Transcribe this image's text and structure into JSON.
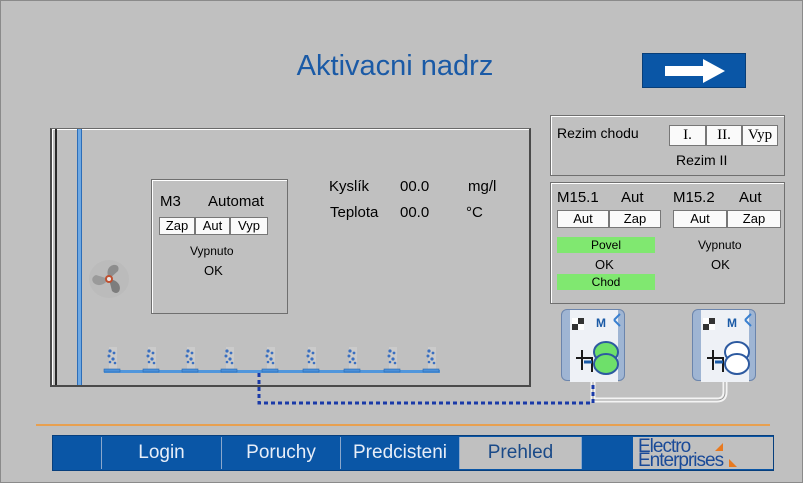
{
  "header": {
    "title": "Aktivacni nadrz",
    "next_icon": "right-arrow-icon"
  },
  "m3": {
    "name": "M3",
    "mode": "Automat",
    "buttons": [
      "Zap",
      "Aut",
      "Vyp"
    ],
    "state": "Vypnuto",
    "status": "OK"
  },
  "readings": {
    "oxygen_label": "Kyslík",
    "oxygen_value": "00.0",
    "oxygen_unit": "mg/l",
    "temp_label": "Teplota",
    "temp_value": "00.0",
    "temp_unit": "°C"
  },
  "rezim": {
    "label": "Rezim chodu",
    "buttons": [
      "I.",
      "II.",
      "Vyp"
    ],
    "current": "Rezim II"
  },
  "m151": {
    "name": "M15.1",
    "mode": "Aut",
    "buttons": [
      "Aut",
      "Zap"
    ],
    "command": "Povel",
    "status": "OK",
    "run": "Chod"
  },
  "m152": {
    "name": "M15.2",
    "mode": "Aut",
    "buttons": [
      "Aut",
      "Zap"
    ],
    "state": "Vypnuto",
    "status": "OK"
  },
  "nav": {
    "items": [
      "Login",
      "Poruchy",
      "Predcisteni",
      "Prehled"
    ],
    "active": "Prehled"
  },
  "logo": {
    "line1": "Electro",
    "line2": "Enterprises"
  },
  "colors": {
    "accent": "#0a56a6",
    "active_green": "#80e870",
    "title_blue": "#1a5aa6"
  },
  "icons": {
    "fan": "fan-icon",
    "motor": "blower-motor-icon",
    "diffuser": "air-bubble-icon"
  }
}
